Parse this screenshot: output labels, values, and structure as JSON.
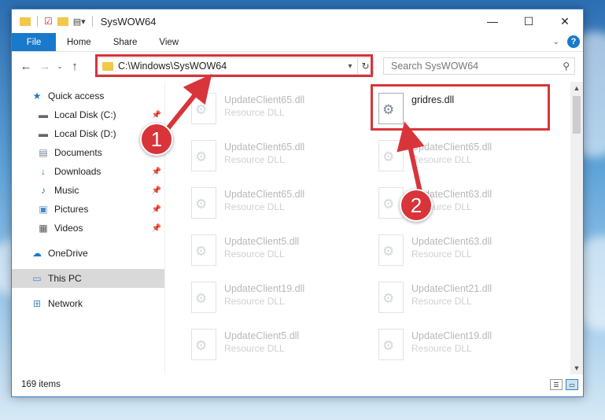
{
  "window": {
    "title": "SysWOW64",
    "controls": {
      "minimize": "—",
      "maximize": "☐",
      "close": "✕"
    }
  },
  "ribbon": {
    "tabs": [
      {
        "label": "File"
      },
      {
        "label": "Home"
      },
      {
        "label": "Share"
      },
      {
        "label": "View"
      }
    ],
    "help_label": "?"
  },
  "address": {
    "path": "C:\\Windows\\SysWOW64",
    "search_placeholder": "Search SysWOW64"
  },
  "sidebar": {
    "items": [
      {
        "label": "Quick access",
        "icon": "star-icon",
        "pinned": false
      },
      {
        "label": "Local Disk (C:)",
        "icon": "drive-icon",
        "pinned": true
      },
      {
        "label": "Local Disk (D:)",
        "icon": "drive-icon",
        "pinned": false
      },
      {
        "label": "Documents",
        "icon": "documents-icon",
        "pinned": true
      },
      {
        "label": "Downloads",
        "icon": "download-icon",
        "pinned": true
      },
      {
        "label": "Music",
        "icon": "music-icon",
        "pinned": true
      },
      {
        "label": "Pictures",
        "icon": "pictures-icon",
        "pinned": true
      },
      {
        "label": "Videos",
        "icon": "videos-icon",
        "pinned": true
      },
      {
        "label": "OneDrive",
        "icon": "cloud-icon",
        "pinned": false
      },
      {
        "label": "This PC",
        "icon": "computer-icon",
        "pinned": false,
        "selected": true
      },
      {
        "label": "Network",
        "icon": "network-icon",
        "pinned": false
      }
    ]
  },
  "files": {
    "left": [
      {
        "name": "UpdateClient65.dll",
        "type": "Resource DLL"
      },
      {
        "name": "UpdateClient65.dll",
        "type": "Resource DLL"
      },
      {
        "name": "UpdateClient65.dll",
        "type": "Resource DLL"
      },
      {
        "name": "UpdateClient5.dll",
        "type": "Resource DLL"
      },
      {
        "name": "UpdateClient19.dll",
        "type": "Resource DLL"
      },
      {
        "name": "UpdateClient5.dll",
        "type": "Resource DLL"
      }
    ],
    "right": [
      {
        "name": "gridres.dll",
        "type": ""
      },
      {
        "name": "UpdateClient65.dll",
        "type": "Resource DLL"
      },
      {
        "name": "UpdateClient63.dll",
        "type": "Resource DLL"
      },
      {
        "name": "UpdateClient63.dll",
        "type": "Resource DLL"
      },
      {
        "name": "UpdateClient21.dll",
        "type": "Resource DLL"
      },
      {
        "name": "UpdateClient19.dll",
        "type": "Resource DLL"
      }
    ]
  },
  "status": {
    "item_count": "169 items"
  },
  "annotations": {
    "badge1": "1",
    "badge2": "2",
    "highlight_color": "#d9343a"
  }
}
